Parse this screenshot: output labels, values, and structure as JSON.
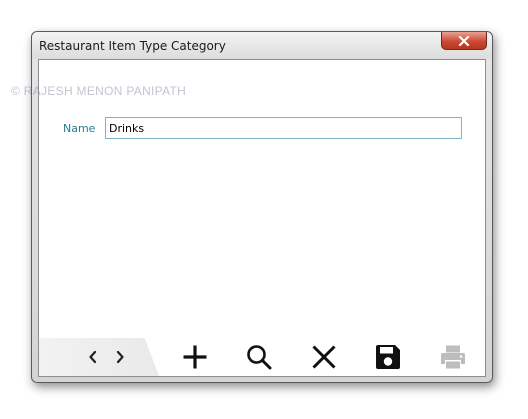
{
  "window": {
    "title": "Restaurant Item Type Category"
  },
  "watermark": "© RAJESH MENON PANIPATH",
  "form": {
    "name_label": "Name",
    "name_value": "Drinks"
  },
  "toolbar": {
    "nav_prev_icon": "chevron-left-icon",
    "nav_next_icon": "chevron-right-icon",
    "add_icon": "plus-icon",
    "search_icon": "search-icon",
    "delete_icon": "close-icon",
    "save_icon": "save-icon",
    "print_icon": "print-icon",
    "print_enabled": false
  },
  "colors": {
    "label": "#2a7a8c",
    "input_border": "#7fb6c6",
    "close_button": "#c7432d",
    "icon_active": "#111111",
    "icon_disabled": "#bdbdbd"
  }
}
